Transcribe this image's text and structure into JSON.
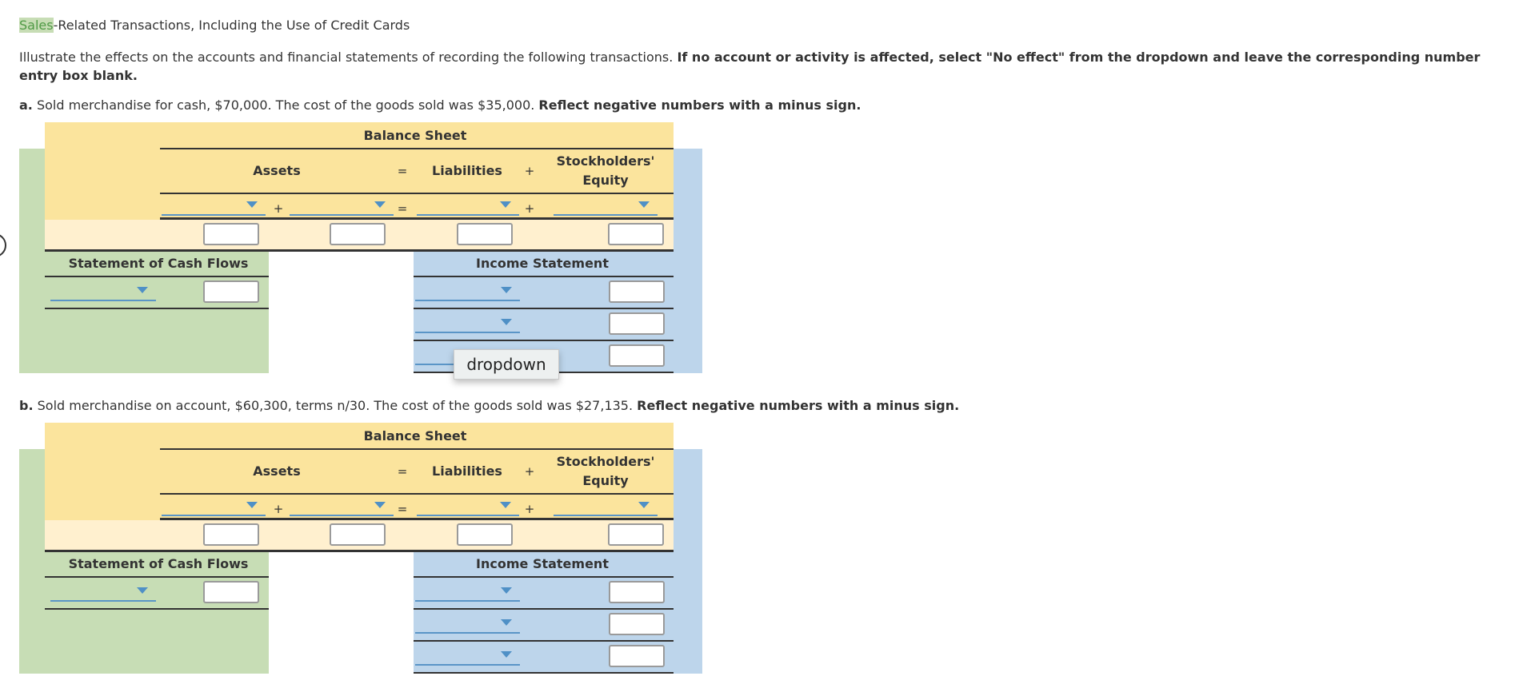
{
  "title": {
    "highlight": "Sales",
    "rest": "-Related Transactions, Including the Use of Credit Cards"
  },
  "instructions": {
    "normal": "Illustrate the effects on the accounts and financial statements of recording the following transactions. ",
    "bold": "If no account or activity is affected, select \"No effect\" from the dropdown and leave the corresponding number entry box blank."
  },
  "table_labels": {
    "balance_sheet": "Balance Sheet",
    "assets": "Assets",
    "equals": "=",
    "liabilities": "Liabilities",
    "plus": "+",
    "equity_line1": "Stockholders'",
    "equity_line2": "Equity",
    "cash_flows": "Statement of Cash Flows",
    "income_statement": "Income Statement"
  },
  "parts": [
    {
      "letter": "a.",
      "text": " Sold merchandise for cash, $70,000. The cost of the goods sold was $35,000. ",
      "bold": "Reflect negative numbers with a minus sign."
    },
    {
      "letter": "b.",
      "text": " Sold merchandise on account, $60,300, terms n/30. The cost of the goods sold was $27,135. ",
      "bold": "Reflect negative numbers with a minus sign."
    }
  ],
  "tooltip": "dropdown",
  "colors": {
    "balance_sheet": "#fbe49d",
    "cash_flows": "#c7ddb5",
    "income_statement": "#bdd5eb",
    "accent": "#4f90c6"
  }
}
